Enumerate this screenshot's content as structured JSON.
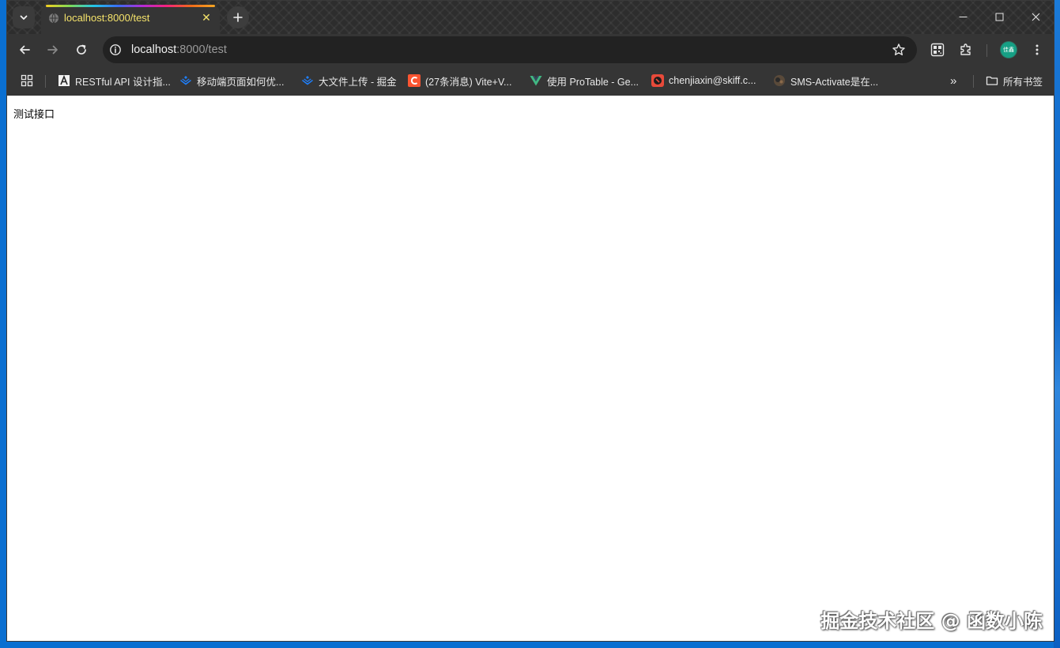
{
  "tab": {
    "title": "localhost:8000/test",
    "close_glyph": "✕"
  },
  "window_controls": {
    "minimize_glyph": "─",
    "maximize_glyph": "☐",
    "close_glyph": "✕"
  },
  "omnibox": {
    "host": "localhost",
    "path": ":8000/test"
  },
  "profile": {
    "avatar_text": "佳鑫",
    "color": "#16a085"
  },
  "bookmarks": {
    "items": [
      {
        "label": "RESTful API 设计指...",
        "icon": "bookmark-favicon-icon"
      },
      {
        "label": "移动端页面如何优...",
        "icon": "juejin-icon"
      },
      {
        "label": "大文件上传 - 掘金",
        "icon": "juejin-icon"
      },
      {
        "label": "(27条消息) Vite+V...",
        "icon": "csdn-icon"
      },
      {
        "label": "使用 ProTable - Ge...",
        "icon": "vue-icon"
      },
      {
        "label": "chenjiaxin@skiff.c...",
        "icon": "skiff-icon"
      },
      {
        "label": "SMS-Activate是在...",
        "icon": "sms-activate-icon"
      }
    ],
    "overflow_glyph": "»",
    "all_bookmarks_label": "所有书签"
  },
  "page": {
    "body_text": "测试接口"
  },
  "watermark": {
    "text": "掘金技术社区 @ 函数小陈"
  },
  "colors": {
    "tab_title": "#f5e36b",
    "page_background": "#ffffff",
    "chrome_dark": "#353535",
    "desktop_blue": "#0a6fd1"
  }
}
